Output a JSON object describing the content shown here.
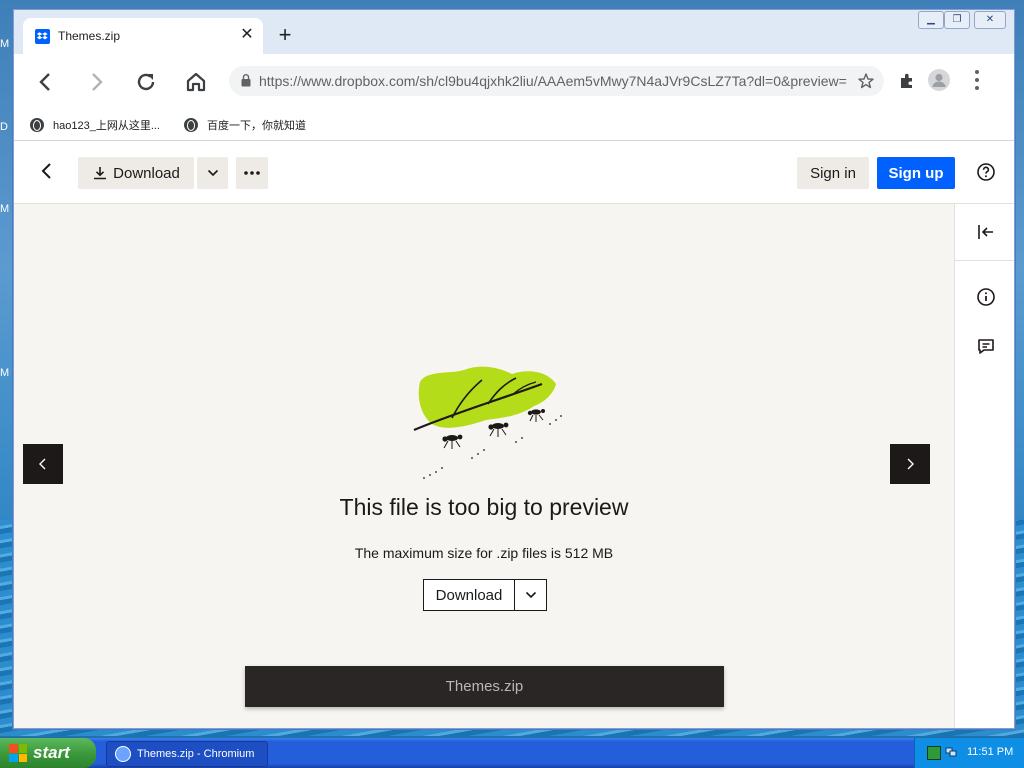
{
  "desktop": {
    "edge_letters": [
      "M",
      "D",
      "M",
      "M"
    ]
  },
  "browser": {
    "tab_title": "Themes.zip",
    "new_tab_label": "+",
    "url": "https://www.dropbox.com/sh/cl9bu4qjxhk2liu/AAAem5vMwy7N4aJVr9CsLZ7Ta?dl=0&preview=",
    "bookmarks": [
      "hao123_上网从这里...",
      "百度一下，你就知道"
    ]
  },
  "dropbox": {
    "download_label": "Download",
    "sign_in_label": "Sign in",
    "sign_up_label": "Sign up",
    "preview_title": "This file is too big to preview",
    "preview_subtitle": "The maximum size for .zip files is 512 MB",
    "inline_download_label": "Download",
    "file_name": "Themes.zip",
    "colors": {
      "accent": "#0061fe",
      "ink": "#1e1919",
      "leaf": "#b4dc19"
    }
  },
  "taskbar": {
    "start_label": "start",
    "task_label": "Themes.zip - Chromium",
    "clock": "11:51 PM"
  }
}
